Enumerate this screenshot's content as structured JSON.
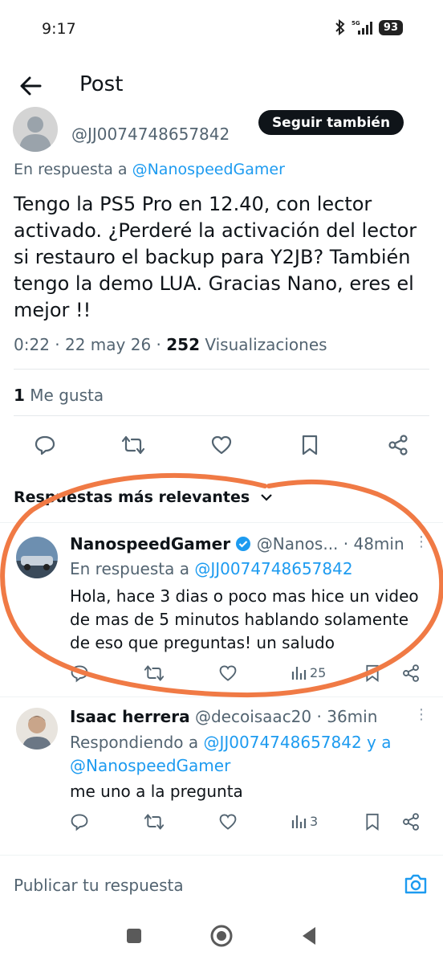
{
  "status_bar": {
    "time": "9:17",
    "battery": "93"
  },
  "header": {
    "title": "Post"
  },
  "tweet": {
    "handle": "@JJ0074748657842",
    "follow_label": "Seguir también",
    "reply_prefix": "En respuesta a",
    "reply_to": "@NanospeedGamer",
    "text": "Tengo la PS5 Pro en 12.40, con lector activado. ¿Perderé la activación del lector si restauro el backup para Y2JB? También tengo la demo LUA. Gracias Nano, eres el mejor !!",
    "time_date": "0:22 · 22 may 26 ·",
    "views_count": "252",
    "views_label": "Visualizaciones",
    "likes_count": "1",
    "likes_label": "Me gusta"
  },
  "sort": {
    "label": "Respuestas más relevantes"
  },
  "replies": [
    {
      "name": "NanospeedGamer",
      "handle": "@Nanos...",
      "time": "· 48min",
      "reply_prefix": "En respuesta a",
      "reply_to": "@JJ0074748657842",
      "text": "Hola, hace 3 dias o poco mas hice un video de mas de 5 minutos hablando solamente de eso que preguntas! un saludo",
      "views": "25"
    },
    {
      "name": "Isaac herrera",
      "handle": "@decoisaac20",
      "time": "· 36min",
      "reply_prefix": "Respondiendo a",
      "reply_to_1": "@JJ0074748657842",
      "reply_and": "y a",
      "reply_to_2": "@NanospeedGamer",
      "text": "me uno a la pregunta",
      "views": "3"
    }
  ],
  "composer": {
    "placeholder": "Publicar tu respuesta"
  },
  "colors": {
    "accent": "#1d9bf0",
    "annotation": "#f07a45",
    "text": "#0f1419",
    "muted": "#536471"
  }
}
